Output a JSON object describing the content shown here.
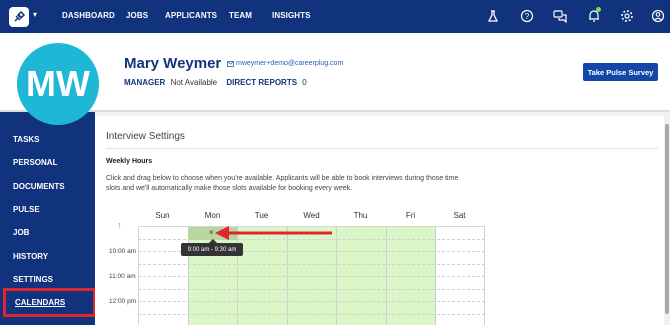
{
  "topnav": {
    "items": [
      "DASHBOARD",
      "JOBS",
      "APPLICANTS",
      "TEAM",
      "INSIGHTS"
    ],
    "icons": [
      "flask-icon",
      "help-icon",
      "chat-icon",
      "bell-icon",
      "gear-icon",
      "user-icon"
    ]
  },
  "profile": {
    "initials": "MW",
    "name": "Mary Weymer",
    "email": "mweymer+demo@careerplug.com",
    "manager_label": "MANAGER",
    "manager_value": "Not Available",
    "reports_label": "DIRECT REPORTS",
    "reports_value": "0",
    "pulse_button": "Take Pulse Survey"
  },
  "sidebar": {
    "items": [
      "TASKS",
      "PERSONAL",
      "DOCUMENTS",
      "PULSE",
      "JOB",
      "HISTORY",
      "SETTINGS",
      "CALENDARS"
    ],
    "active": "CALENDARS"
  },
  "main": {
    "title": "Interview Settings",
    "section": "Weekly Hours",
    "description": "Click and drag below to choose when you're available. Applicants will be able to book interviews during those time slots and we'll automatically make those slots available for booking every week."
  },
  "calendar": {
    "days": [
      "Sun",
      "Mon",
      "Tue",
      "Wed",
      "Thu",
      "Fri",
      "Sat"
    ],
    "times": [
      "10:00 am",
      "11:00 am",
      "12:00 pm"
    ],
    "slot_remove": "×",
    "tooltip": "9:00 am - 9:30 am",
    "colors": {
      "available": "#daf5c6",
      "selected": "#b8d79c",
      "highlight": "#e0262c"
    }
  }
}
